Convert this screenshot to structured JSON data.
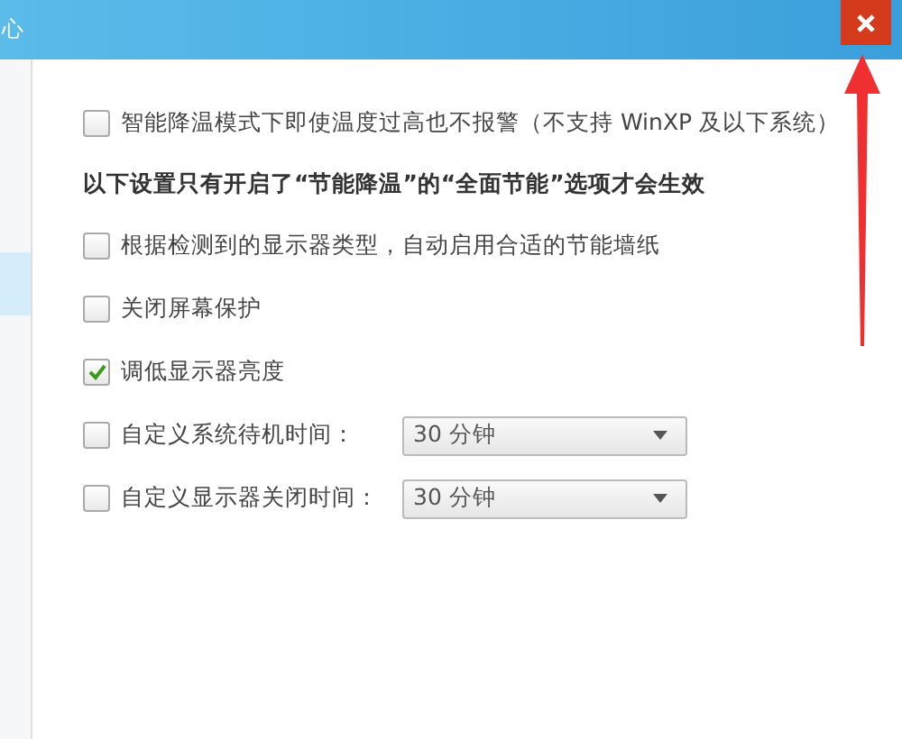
{
  "window": {
    "title": "心"
  },
  "sidebar": {
    "items": [
      {
        "selected": false
      },
      {
        "selected": true
      }
    ]
  },
  "options": [
    {
      "kind": "checkbox",
      "label": "智能降温模式下即使温度过高也不报警（不支持 WinXP 及以下系统）",
      "checked": false
    },
    {
      "kind": "heading",
      "label": "以下设置只有开启了“节能降温”的“全面节能”选项才会生效"
    },
    {
      "kind": "checkbox",
      "label": "根据检测到的显示器类型，自动启用合适的节能墙纸",
      "checked": false
    },
    {
      "kind": "checkbox",
      "label": "关闭屏幕保护",
      "checked": false
    },
    {
      "kind": "checkbox",
      "label": "调低显示器亮度",
      "checked": true
    },
    {
      "kind": "select",
      "label": "自定义系统待机时间：",
      "checked": false,
      "value": "30 分钟"
    },
    {
      "kind": "select",
      "label": "自定义显示器关闭时间：",
      "checked": false,
      "value": "30 分钟"
    }
  ]
}
